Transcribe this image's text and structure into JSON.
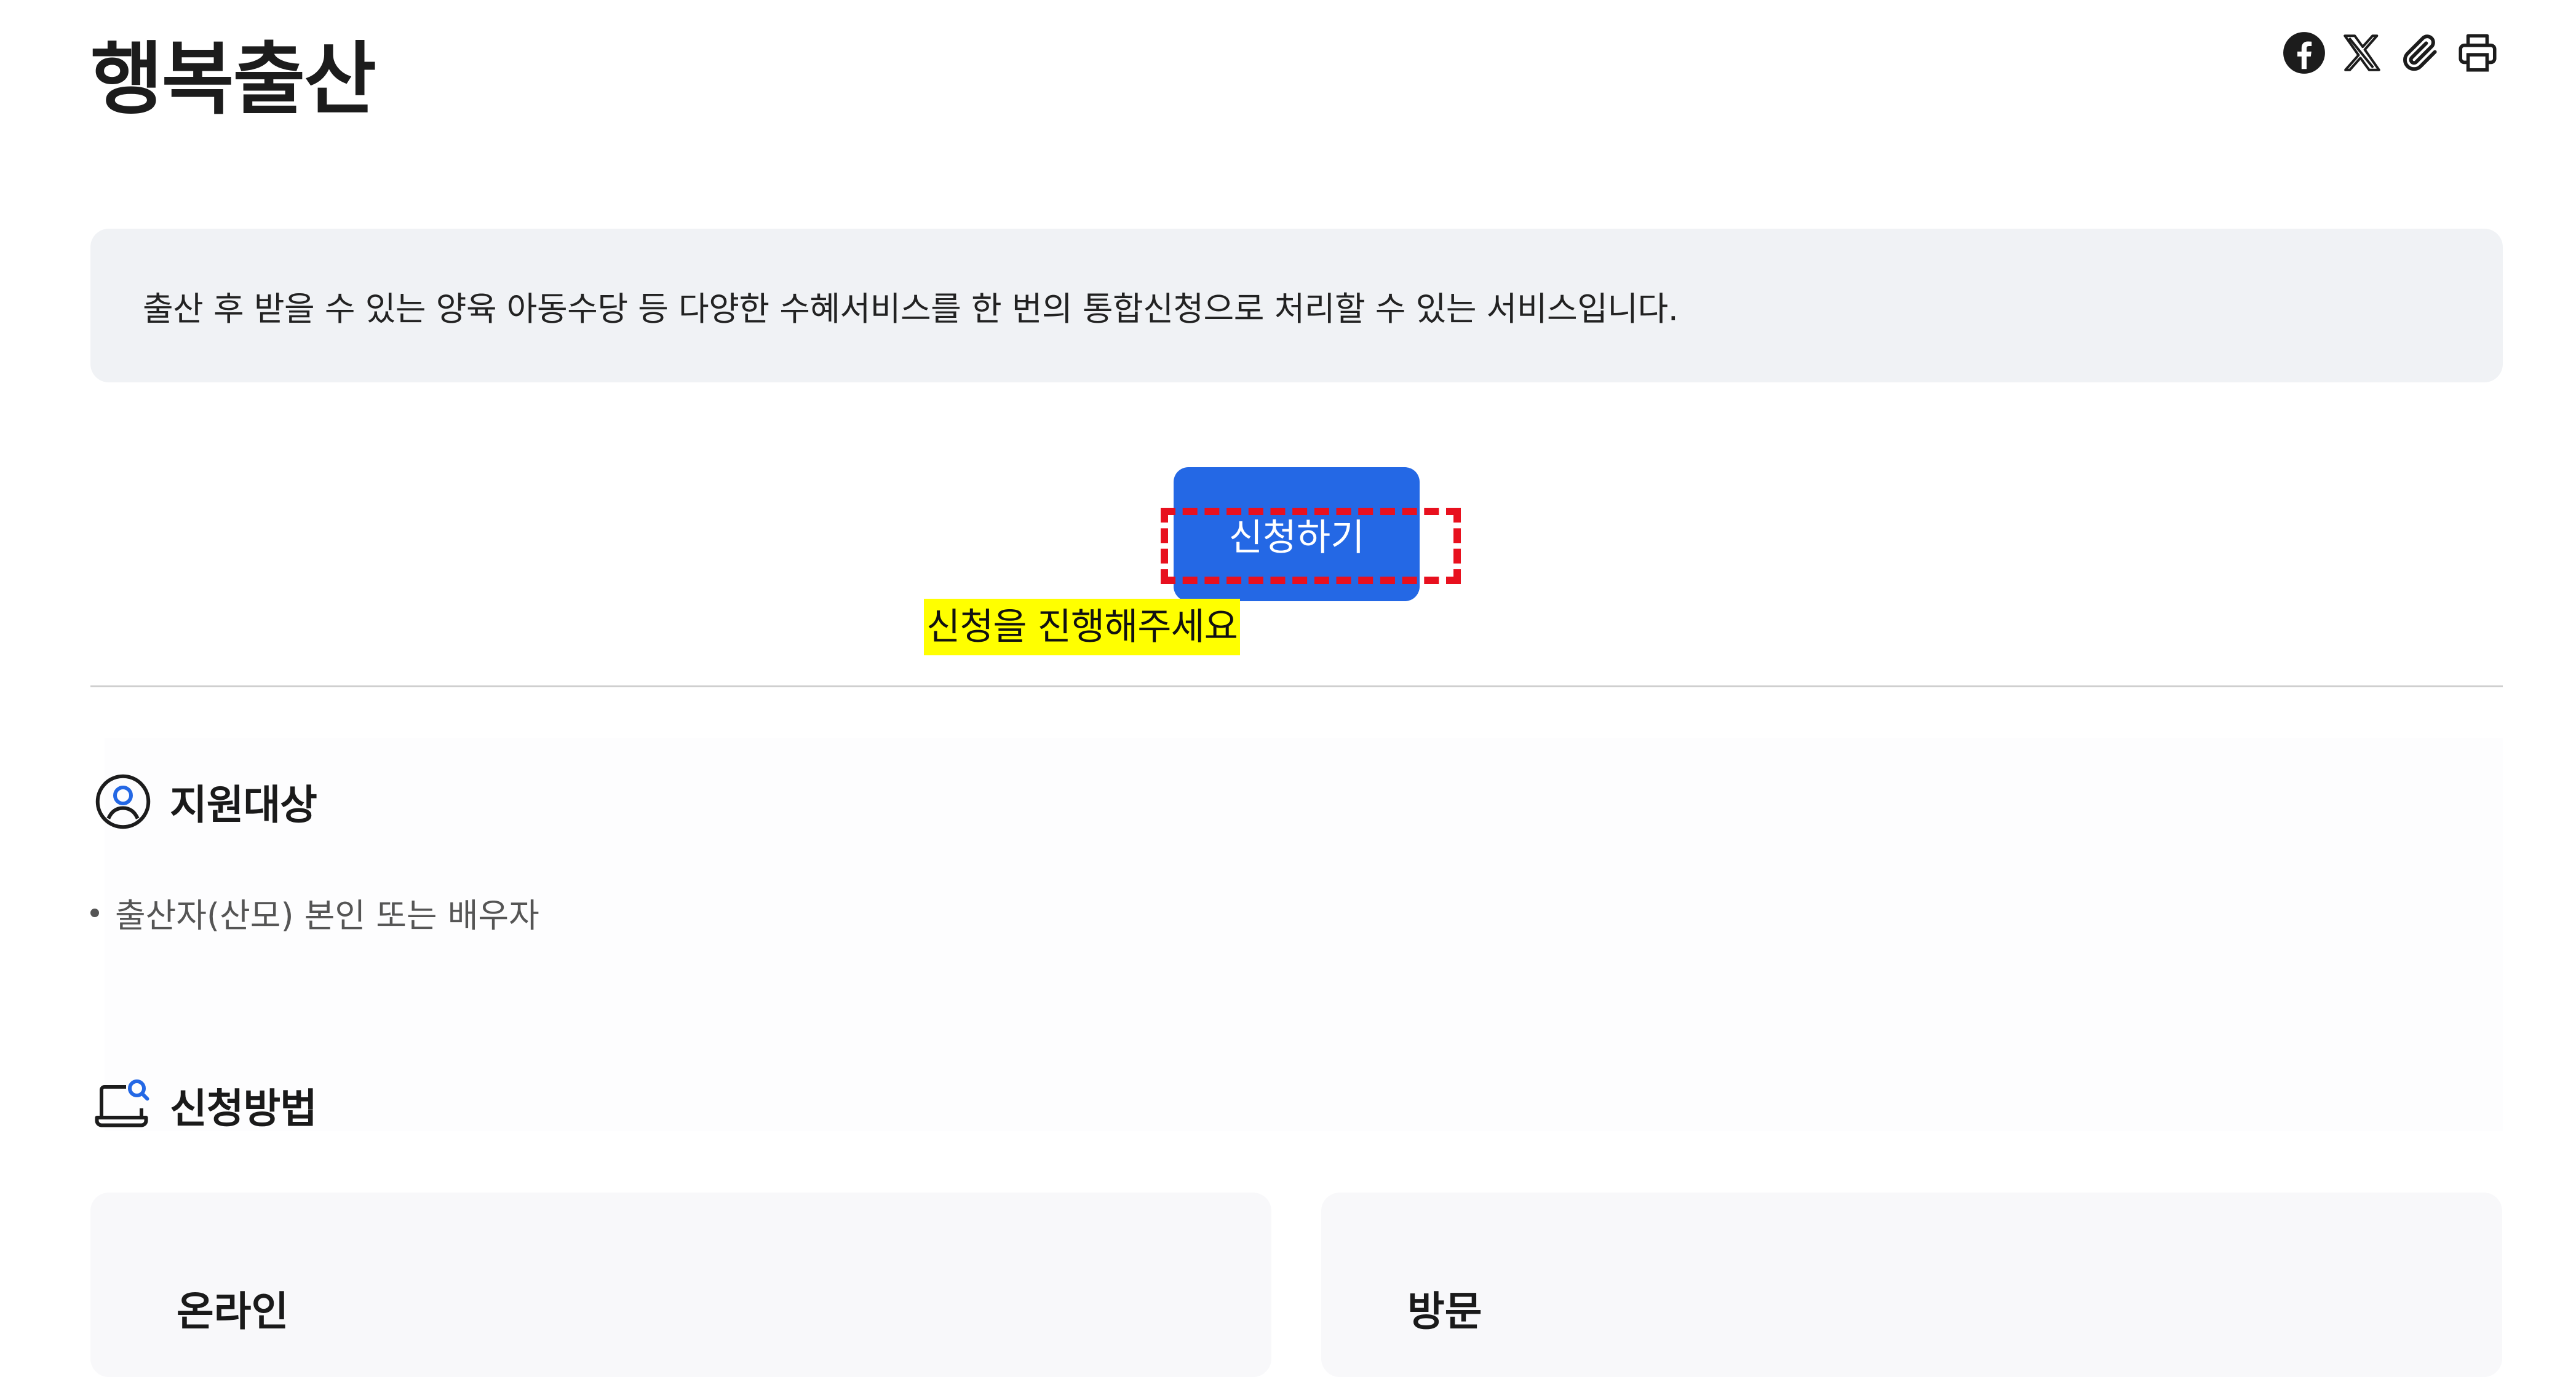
{
  "page": {
    "title": "행복출산"
  },
  "share": {
    "icons": [
      "facebook-icon",
      "x-icon",
      "paperclip-icon",
      "printer-icon"
    ]
  },
  "summary": {
    "text": "출산 후 받을 수 있는 양육 아동수당 등 다양한 수혜서비스를 한 번의 통합신청으로 처리할 수 있는 서비스입니다."
  },
  "apply": {
    "button_label": "신청하기",
    "hint_text": "신청을 진행해주세요"
  },
  "sections": {
    "target": {
      "title": "지원대상",
      "icon": "user-circle-icon",
      "items": [
        "출산자(산모) 본인 또는 배우자"
      ]
    },
    "method": {
      "title": "신청방법",
      "icon": "laptop-search-icon",
      "cards": [
        {
          "title": "온라인"
        },
        {
          "title": "방문"
        }
      ]
    }
  },
  "colors": {
    "primary_button": "#2468e5",
    "summary_background": "#f0f2f5",
    "highlight_dashed": "#e8101e",
    "hint_background": "#ffff00",
    "accent_icon": "#2468e5"
  }
}
